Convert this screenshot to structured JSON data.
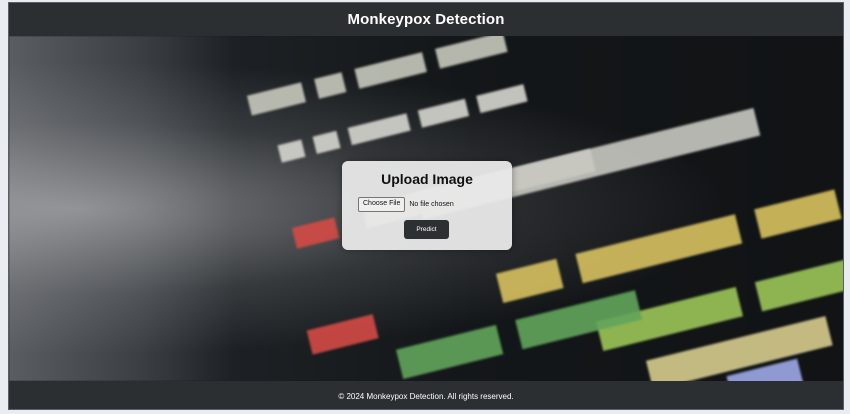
{
  "header": {
    "title": "Monkeypox Detection"
  },
  "background": {
    "description_icon": "code-background-image"
  },
  "upload_panel": {
    "title": "Upload Image",
    "choose_file_label": "Choose File",
    "file_status": "No file chosen",
    "predict_label": "Predict"
  },
  "footer": {
    "text": "© 2024 Monkeypox Detection. All rights reserved."
  },
  "colors": {
    "header_bg": "#2c2f31",
    "footer_bg": "#2c2f31",
    "card_bg": "#e9e9e9",
    "button_bg": "#2d3033"
  }
}
